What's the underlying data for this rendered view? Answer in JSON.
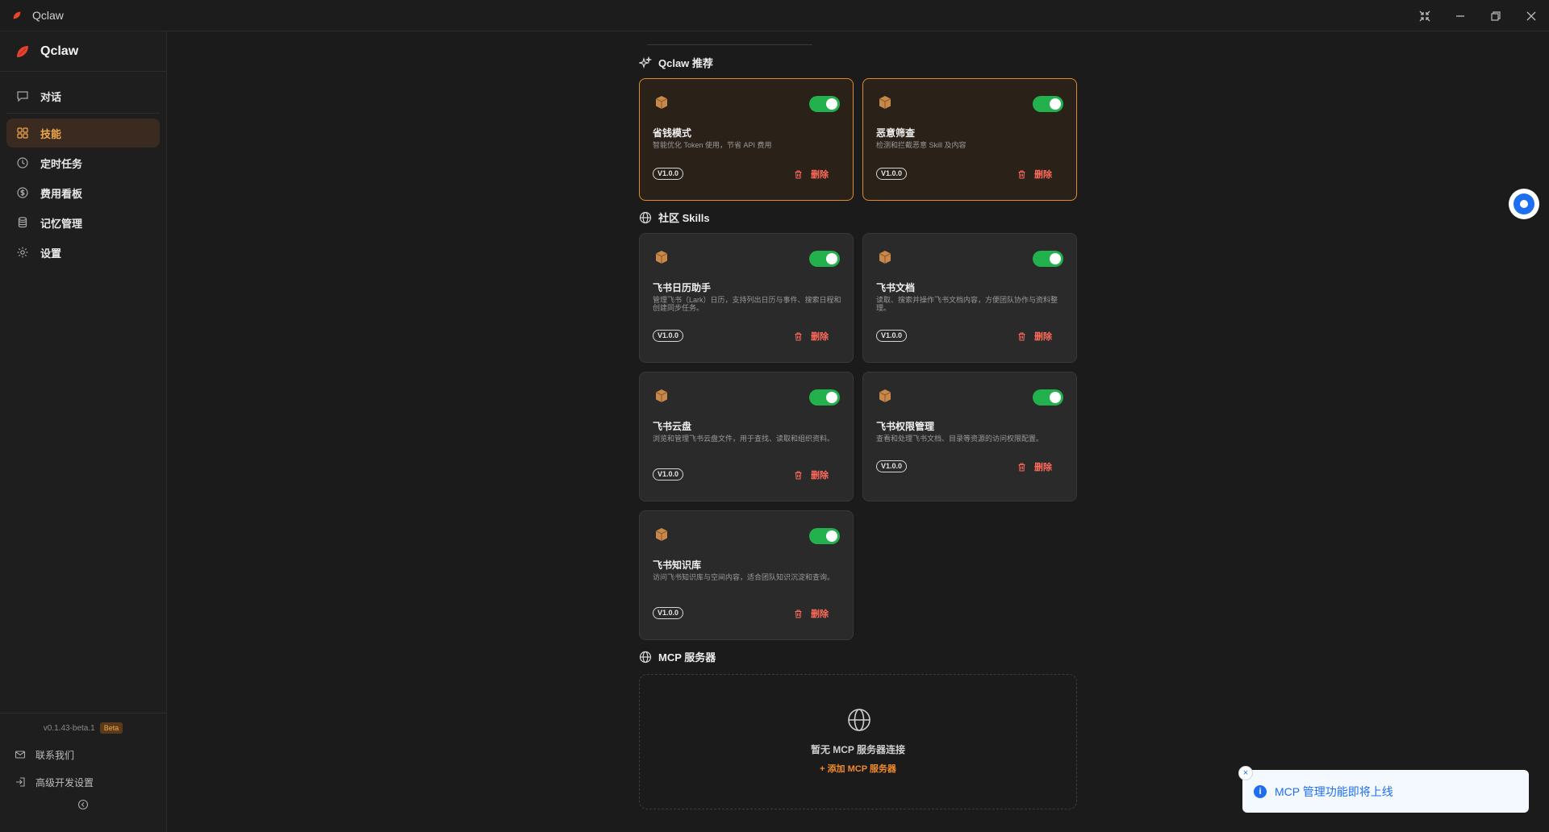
{
  "window": {
    "title": "Qclaw"
  },
  "sidebar": {
    "brand": "Qclaw",
    "items": [
      {
        "label": "对话",
        "icon": "chat-icon"
      },
      {
        "label": "技能",
        "icon": "grid-icon",
        "active": true
      },
      {
        "label": "定时任务",
        "icon": "clock-icon"
      },
      {
        "label": "费用看板",
        "icon": "dollar-icon"
      },
      {
        "label": "记忆管理",
        "icon": "database-icon"
      },
      {
        "label": "设置",
        "icon": "gear-icon"
      }
    ],
    "version": "v0.1.43-beta.1",
    "beta_badge": "Beta",
    "contact_label": "联系我们",
    "dev_settings_label": "高级开发设置"
  },
  "sections": {
    "recommended_title": "Qclaw 推荐",
    "community_title": "社区 Skills",
    "mcp_title": "MCP 服务器"
  },
  "recommended_skills": [
    {
      "name": "省钱模式",
      "desc": "智能优化 Token 使用，节省 API 费用",
      "version": "V1.0.0",
      "enabled": true,
      "delete_label": "删除"
    },
    {
      "name": "恶意筛查",
      "desc": "检测和拦截恶意 Skill 及内容",
      "version": "V1.0.0",
      "enabled": true,
      "delete_label": "删除"
    }
  ],
  "community_skills": [
    {
      "name": "飞书日历助手",
      "desc": "管理飞书（Lark）日历，支持列出日历与事件、搜索日程和创建同步任务。",
      "version": "V1.0.0",
      "enabled": true,
      "delete_label": "删除"
    },
    {
      "name": "飞书文档",
      "desc": "读取、搜索并操作飞书文档内容，方便团队协作与资料整理。",
      "version": "V1.0.0",
      "enabled": true,
      "delete_label": "删除"
    },
    {
      "name": "飞书云盘",
      "desc": "浏览和管理飞书云盘文件，用于查找、读取和组织资料。",
      "version": "V1.0.0",
      "enabled": true,
      "delete_label": "删除"
    },
    {
      "name": "飞书权限管理",
      "desc": "查看和处理飞书文档、目录等资源的访问权限配置。",
      "version": "V1.0.0",
      "enabled": true,
      "delete_label": "删除"
    },
    {
      "name": "飞书知识库",
      "desc": "访问飞书知识库与空间内容，适合团队知识沉淀和查询。",
      "version": "V1.0.0",
      "enabled": true,
      "delete_label": "删除"
    }
  ],
  "mcp": {
    "empty_text": "暂无 MCP 服务器连接",
    "add_label": "+ 添加 MCP 服务器"
  },
  "toast": {
    "message": "MCP 管理功能即将上线",
    "close_glyph": "×",
    "info_glyph": "i"
  },
  "colors": {
    "accent": "#f0a94f",
    "toggle_on": "#22b14c",
    "delete": "#ff6a5a",
    "featured_border": "#e08a2c",
    "toast_blue": "#1e6ef0"
  }
}
